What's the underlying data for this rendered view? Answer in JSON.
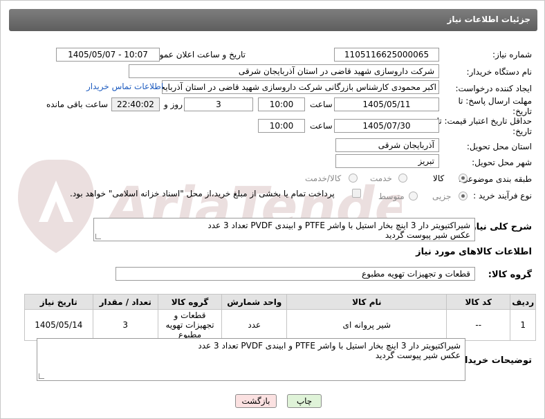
{
  "header": {
    "title": "جزئیات اطلاعات نیاز"
  },
  "need_number": {
    "label": "شماره نیاز:",
    "value": "1105116625000065"
  },
  "announce": {
    "label": "تاریخ و ساعت اعلان عمومی:",
    "value": "1405/05/07 - 10:07"
  },
  "buyer_org": {
    "label": "نام دستگاه خریدار:",
    "value": "شرکت داروسازی شهید قاضی در استان آذربایجان شرقی"
  },
  "creator": {
    "label": "ایجاد کننده درخواست:",
    "value": "اکبر محمودی  کارشناس بازرگانی شرکت داروسازی شهید قاضی در استان آذربایجان",
    "contact_link": "اطلاعات تماس خریدار"
  },
  "reply_deadline": {
    "label": "مهلت ارسال پاسخ: تا تاریخ:",
    "date": "1405/05/11",
    "time_label": "ساعت",
    "time": "10:00",
    "days": "3",
    "days_label": "روز و",
    "remaining": "22:40:02",
    "remaining_label": "ساعت باقی مانده"
  },
  "price_validity": {
    "label": "حداقل تاریخ اعتبار قیمت: تا تاریخ:",
    "date": "1405/07/30",
    "time_label": "ساعت",
    "time": "10:00"
  },
  "delivery_province": {
    "label": "استان محل تحویل:",
    "value": "آذربایجان شرقی"
  },
  "delivery_city": {
    "label": "شهر محل تحویل:",
    "value": "تبریز"
  },
  "category": {
    "label": "طبقه بندی موضوعی:",
    "options": [
      "کالا",
      "خدمت",
      "کالا/خدمت"
    ],
    "selected": "کالا"
  },
  "process_type": {
    "label": "نوع فرآیند خرید :",
    "options": [
      "جزیی",
      "متوسط"
    ],
    "selected": "جزیی",
    "payment_note": "پرداخت تمام یا بخشی از مبلغ خرید،از محل \"اسناد خزانه اسلامی\" خواهد بود."
  },
  "description": {
    "label": "شرح کلی نیاز:",
    "line1": "شیراکتیویتر دار 3 اینچ بخار استیل با واشر PTFE و ابیندی PVDF تعداد 3 عدد",
    "line2": "عکس شیر پیوست گردید"
  },
  "goods_info": {
    "title": "اطلاعات کالاهای مورد نیاز"
  },
  "goods_group": {
    "label": "گروه کالا:",
    "value": "قطعات و تجهیزات تهویه مطبوع"
  },
  "table": {
    "headers": [
      "ردیف",
      "کد کالا",
      "نام کالا",
      "واحد شمارش",
      "گروه کالا",
      "تعداد / مقدار",
      "تاریخ نیاز"
    ],
    "rows": [
      [
        "1",
        "--",
        "شیر پروانه ای",
        "عدد",
        "قطعات و تجهیزات تهویه مطبوع",
        "3",
        "1405/05/14"
      ]
    ]
  },
  "buyer_notes": {
    "label": "توضیحات خریدار:",
    "line1": "شیراکتیویتر دار 3 اینچ بخار استیل با واشر PTFE و ابیندی PVDF تعداد 3 عدد",
    "line2": "عکس شیر پیوست گردید"
  },
  "buttons": {
    "print": "چاپ",
    "back": "بازگشت"
  },
  "colors": {
    "header": "#6b6b6b",
    "link": "#1d5bbf",
    "print_btn": "#dff3d8",
    "back_btn": "#fbe1e1"
  },
  "watermark": {
    "text": "AriaTender.net"
  }
}
